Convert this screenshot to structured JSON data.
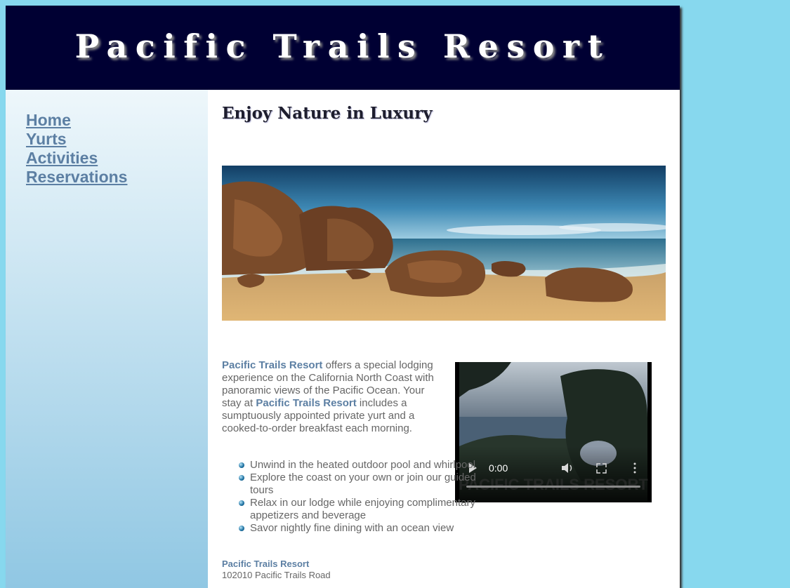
{
  "header": {
    "title": "Pacific Trails Resort"
  },
  "nav": {
    "items": [
      {
        "label": "Home"
      },
      {
        "label": "Yurts"
      },
      {
        "label": "Activities"
      },
      {
        "label": "Reservations"
      }
    ]
  },
  "main": {
    "heading": "Enjoy Nature in Luxury",
    "intro": {
      "resort_name": "Pacific Trails Resort",
      "text1": " offers a special lodging experience on the California North Coast with panoramic views of the Pacific Ocean. Your stay at ",
      "resort_name2": "Pacific Trails Resort",
      "text2": " includes a sumptuously appointed private yurt and a cooked-to-order breakfast each morning."
    },
    "features": [
      "Unwind in the heated outdoor pool and whirlpool",
      "Explore the coast on your own or join our guided tours",
      "Relax in our lodge while enjoying complimentary appetizers and beverage",
      "Savor nightly fine dining with an ocean view"
    ],
    "video": {
      "time": "0:00",
      "watermark": "PACIFIC TRAILS RESORT"
    },
    "contact": {
      "name": "Pacific Trails Resort",
      "address": "102010 Pacific Trails Road"
    }
  },
  "colors": {
    "page_background": "#87d8ee",
    "header_background": "#000033",
    "link": "#5c7fa3",
    "body_text": "#666666"
  }
}
